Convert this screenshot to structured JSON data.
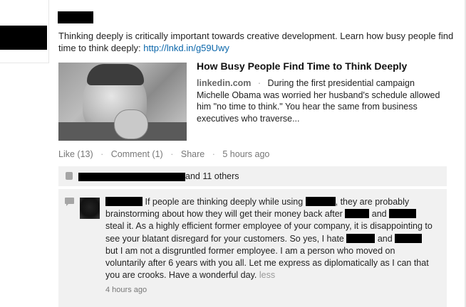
{
  "post": {
    "text_prefix": "Thinking deeply is critically important towards creative development. Learn how busy people find time to think deeply: ",
    "link_text": "http://lnkd.in/g59Uwy",
    "article": {
      "title": "How Busy People Find Time to Think Deeply",
      "domain": "linkedin.com",
      "bullet": "·",
      "excerpt": "During the first presidential campaign Michelle Obama was worried her husband's schedule allowed him \"no time to think.\" You hear the same from business executives who traverse..."
    },
    "actions": {
      "like": "Like (13)",
      "comment": "Comment (1)",
      "share": "Share",
      "time": "5 hours ago",
      "sep": "·"
    },
    "likes_suffix": "and 11 others"
  },
  "comment": {
    "t1": " If people are thinking deeply while using ",
    "t2": ", they are probably brainstorming about how they will get their money back after ",
    "t3": " and ",
    "t4": " steal it. As a highly efficient former employee of your company, it is disappointing to see your blatant disregard for your customers. So yes, I hate ",
    "t5": " and ",
    "t6": " but I am not a disgruntled former employee. I am a person who moved on voluntarily after 6 years with you all. Let me express as diplomatically as I can that you are crooks. Have a wonderful day. ",
    "less": "less",
    "time": "4 hours ago"
  },
  "colors": {
    "link": "#0a66aa",
    "panel_bg": "#f1f1f1",
    "meta_text": "#777777"
  }
}
